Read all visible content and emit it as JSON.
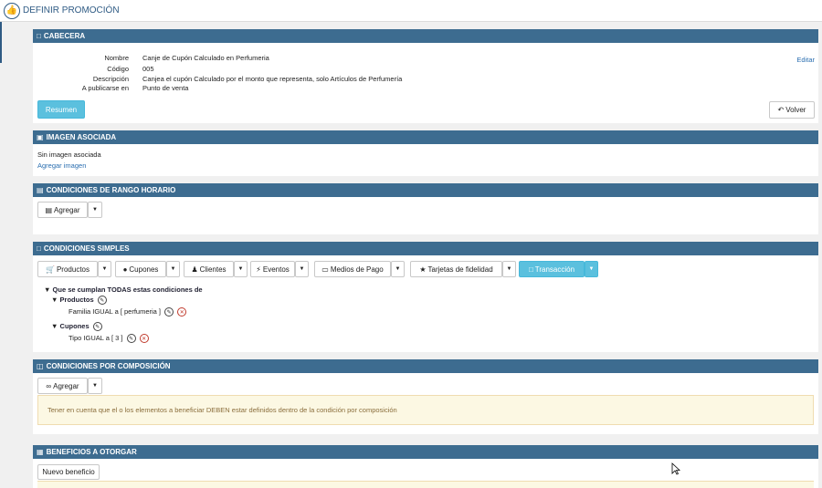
{
  "header": {
    "title": "DEFINIR PROMOCIÓN",
    "icon": "thumbs-up-icon"
  },
  "cabecera": {
    "title": "CABECERA",
    "fields": [
      {
        "label": "Nombre",
        "value": "Canje de Cupón Calculado en Perfumeria"
      },
      {
        "label": "Código",
        "value": "005"
      },
      {
        "label": "Descripción",
        "value": "Canjea el cupón Calculado por el monto que representa, solo Artículos de Perfumería"
      },
      {
        "label": "A publicarse en",
        "value": "Punto de venta"
      }
    ],
    "edit_label": "Editar",
    "resumen_label": "Resumen",
    "volver_label": "Volver"
  },
  "imagen": {
    "title": "IMAGEN ASOCIADA",
    "status": "Sin imagen asociada",
    "add_link": "Agregar imagen"
  },
  "rango": {
    "title": "CONDICIONES DE RANGO HORARIO",
    "add_label": "Agregar"
  },
  "simples": {
    "title": "CONDICIONES SIMPLES",
    "buttons": [
      "Productos",
      "Cupones",
      "Clientes",
      "Eventos",
      "Medios de Pago",
      "Tarjetas de fidelidad",
      "Transacción"
    ],
    "tree_root": "Que se cumplan TODAS estas condiciones de",
    "groups": [
      {
        "name": "Productos",
        "item": "Familia IGUAL a [ perfumeria ]"
      },
      {
        "name": "Cupones",
        "item": "Tipo IGUAL a [ 3 ]"
      }
    ]
  },
  "composicion": {
    "title": "CONDICIONES POR COMPOSICIÓN",
    "add_label": "Agregar",
    "warning": "Tener en cuenta que el o los elementos a beneficiar DEBEN estar definidos dentro de la condición por composición"
  },
  "beneficios": {
    "title": "BENEFICIOS A OTORGAR",
    "new_label": "Nuevo beneficio"
  },
  "colors": {
    "header_bar": "#3d6c90",
    "primary": "#5bc0de",
    "warning_bg": "#fcf8e3",
    "link": "#2a6eb0"
  }
}
